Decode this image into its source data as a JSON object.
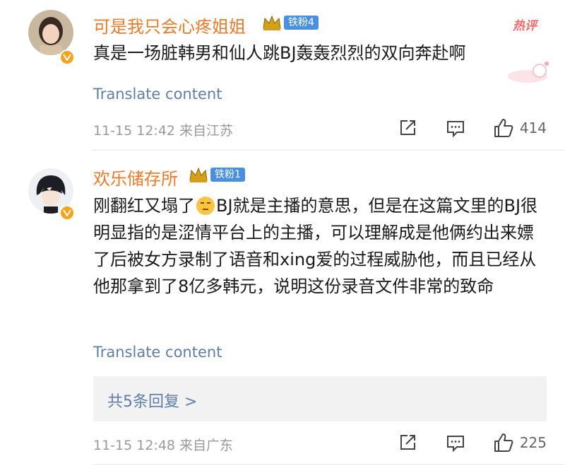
{
  "comments": [
    {
      "username": "可是我只会心疼姐姐",
      "fan_badge": "铁粉4",
      "hot_label": "热评",
      "text": "真是一场脏韩男和仙人跳BJ轰轰烈烈的双向奔赴啊",
      "translate": "Translate content",
      "timestamp": "11-15 12:42 来自江苏",
      "likes": "414"
    },
    {
      "username": "欢乐储存所",
      "fan_badge": "铁粉1",
      "text_part1": "刚翻红又塌了",
      "text_part2": "BJ就是主播的意思，但是在这篇文里的BJ很明显指的是涩情平台上的主播，可以理解成是他俩约出来嫖了后被女方录制了语音和xing爱的过程威胁他，而且已经从他那拿到了8亿多韩元，说明这份录音文件非常的致命",
      "translate": "Translate content",
      "replies": "共5条回复 >",
      "timestamp": "11-15 12:48 来自广东",
      "likes": "225"
    }
  ],
  "colors": {
    "username": "#ec7a29",
    "link": "#5e7ea8",
    "badge": "#4a90e2",
    "hot": "#f36b6b",
    "verified": "#f7a21b"
  }
}
